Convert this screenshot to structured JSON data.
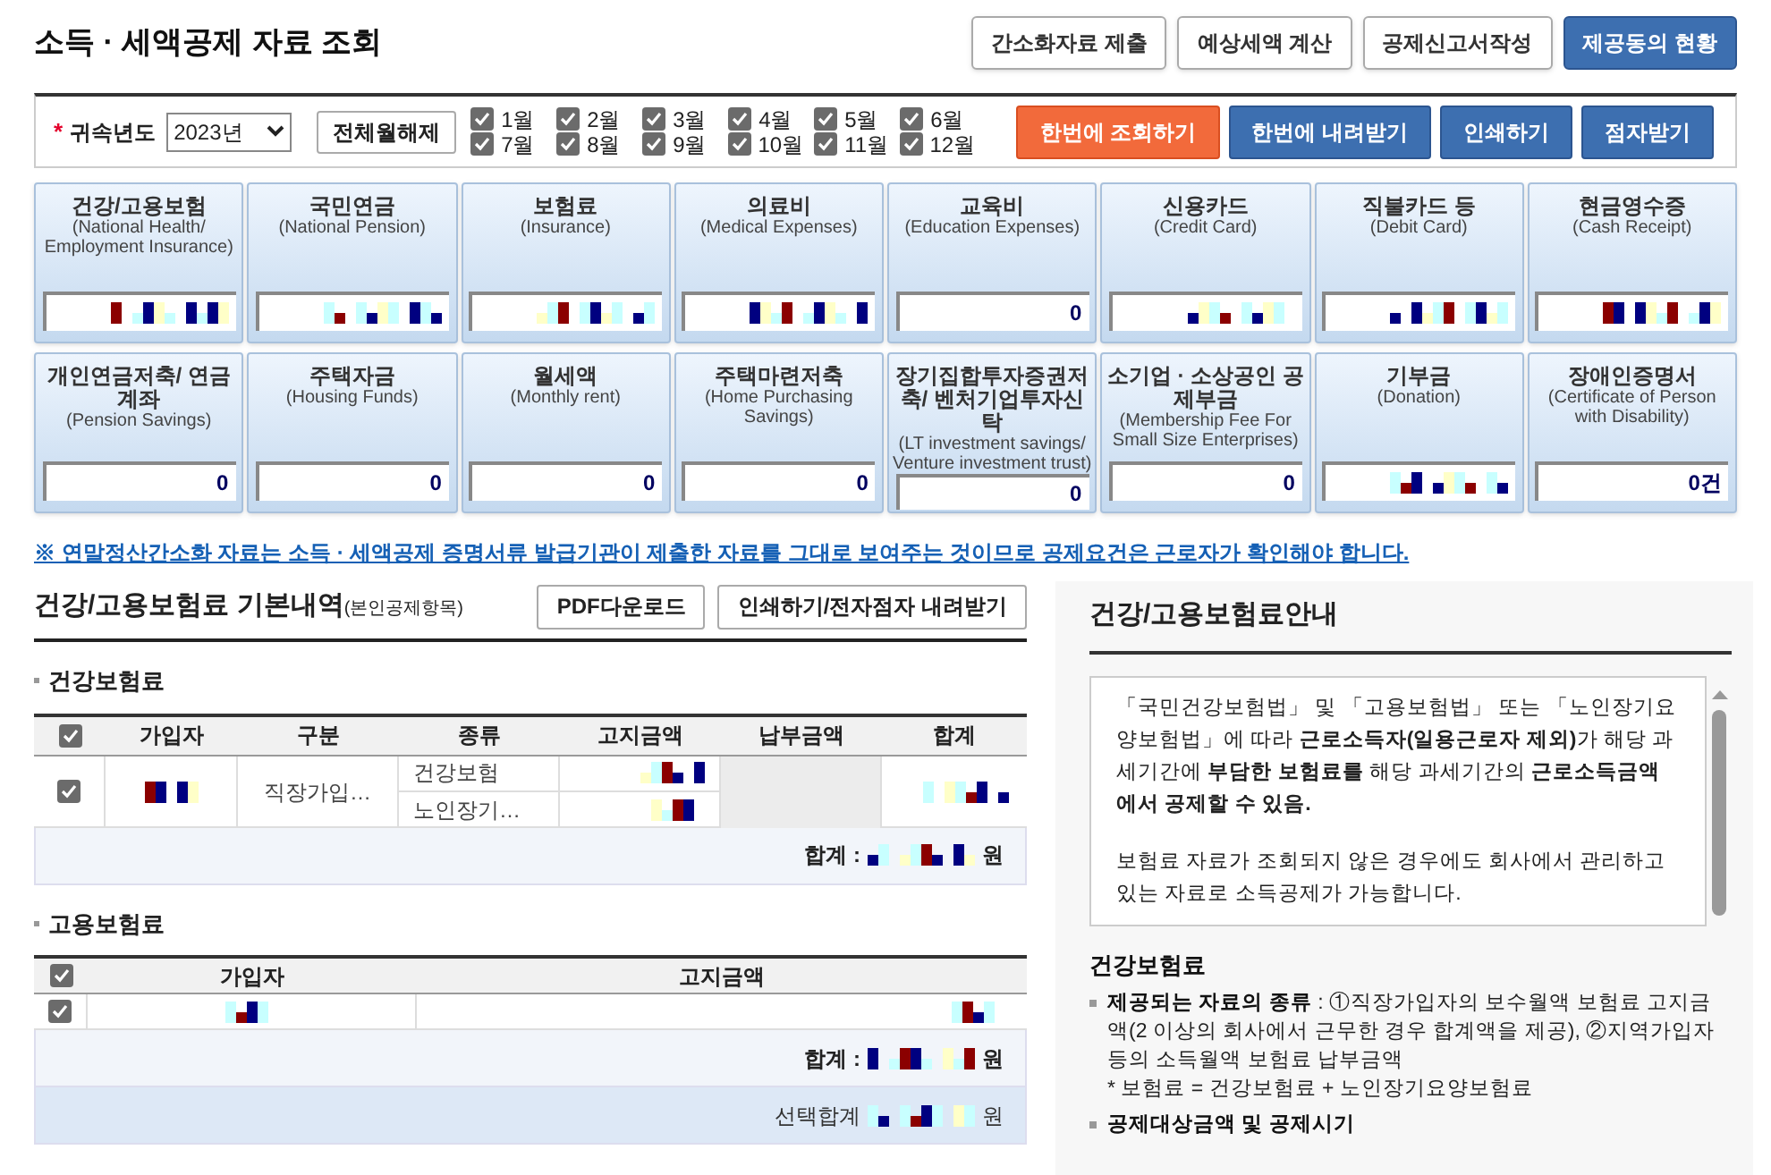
{
  "title": "소득 · 세액공제 자료 조회",
  "header_buttons": [
    {
      "label": "간소화자료 제출",
      "selected": false
    },
    {
      "label": "예상세액 계산",
      "selected": false
    },
    {
      "label": "공제신고서작성",
      "selected": false
    },
    {
      "label": "제공동의 현황",
      "selected": true
    }
  ],
  "toolbar": {
    "required_mark": "*",
    "year_label": "귀속년도",
    "year_value": "2023년",
    "clear_button": "전체월해제",
    "months": [
      {
        "label": "1월",
        "checked": true
      },
      {
        "label": "2월",
        "checked": true
      },
      {
        "label": "3월",
        "checked": true
      },
      {
        "label": "4월",
        "checked": true
      },
      {
        "label": "5월",
        "checked": true
      },
      {
        "label": "6월",
        "checked": true
      },
      {
        "label": "7월",
        "checked": true
      },
      {
        "label": "8월",
        "checked": true
      },
      {
        "label": "9월",
        "checked": true
      },
      {
        "label": "10월",
        "checked": true
      },
      {
        "label": "11월",
        "checked": true
      },
      {
        "label": "12월",
        "checked": true
      }
    ],
    "actions": [
      {
        "label": "한번에 조회하기",
        "kind": "orange"
      },
      {
        "label": "한번에 내려받기",
        "kind": "blue"
      },
      {
        "label": "인쇄하기",
        "kind": "blue"
      },
      {
        "label": "점자받기",
        "kind": "blue"
      }
    ]
  },
  "cards": [
    {
      "title": "건강/고용보험",
      "subtitle": "(National Health/ Employment Insurance)",
      "redacted": true
    },
    {
      "title": "국민연금",
      "subtitle": "(National Pension)",
      "redacted": true
    },
    {
      "title": "보험료",
      "subtitle": "(Insurance)",
      "redacted": true
    },
    {
      "title": "의료비",
      "subtitle": "(Medical Expenses)",
      "redacted": true
    },
    {
      "title": "교육비",
      "subtitle": "(Education Expenses)",
      "value": "0"
    },
    {
      "title": "신용카드",
      "subtitle": "(Credit Card)",
      "redacted": true
    },
    {
      "title": "직불카드 등",
      "subtitle": "(Debit Card)",
      "redacted": true
    },
    {
      "title": "현금영수증",
      "subtitle": "(Cash Receipt)",
      "redacted": true
    },
    {
      "title": "개인연금저축/ 연금계좌",
      "subtitle": "(Pension Savings)",
      "value": "0"
    },
    {
      "title": "주택자금",
      "subtitle": "(Housing Funds)",
      "value": "0"
    },
    {
      "title": "월세액",
      "subtitle": "(Monthly rent)",
      "value": "0"
    },
    {
      "title": "주택마련저축",
      "subtitle": "(Home Purchasing Savings)",
      "value": "0"
    },
    {
      "title": "장기집합투자증권저축/ 벤처기업투자신탁",
      "subtitle": "(LT investment savings/ Venture investment trust)",
      "value": "0"
    },
    {
      "title": "소기업 · 소상공인 공제부금",
      "subtitle": "(Membership Fee For Small Size Enterprises)",
      "value": "0"
    },
    {
      "title": "기부금",
      "subtitle": "(Donation)",
      "redacted": true
    },
    {
      "title": "장애인증명서",
      "subtitle": "(Certificate of Person with Disability)",
      "value": "0건"
    }
  ],
  "notice": "※ 연말정산간소화 자료는 소득 · 세액공제 증명서류 발급기관이 제출한 자료를 그대로 보여주는 것이므로 공제요건은 근로자가 확인해야 합니다.",
  "detail": {
    "title": "건강/고용보험료 기본내역",
    "title_note": "(본인공제항목)",
    "buttons": [
      "PDF다운로드",
      "인쇄하기/전자점자 내려받기"
    ],
    "health": {
      "heading": "건강보험료",
      "header_checked": true,
      "columns": [
        "가입자",
        "구분",
        "종류",
        "고지금액",
        "납부금액",
        "합계"
      ],
      "rows": [
        {
          "checked": true,
          "category": "직장가입…",
          "types": [
            "건강보험",
            "노인장기…"
          ]
        }
      ],
      "total_label": "합계 :",
      "unit": "원"
    },
    "employment": {
      "heading": "고용보험료",
      "header_checked": true,
      "columns": [
        "가입자",
        "고지금액"
      ],
      "rows": [
        {
          "checked": true
        }
      ],
      "total_label": "합계 :",
      "unit": "원"
    },
    "selected_total_label": "선택합계",
    "selected_total_unit": "원"
  },
  "guide": {
    "title": "건강/고용보험료안내",
    "paragraphs": [
      "「국민건강보험법」 및 「고용보험법」 또는 「노인장기요양보험법」에 따라 **근로소득자(일용근로자 제외)**가 해당 과세기간에 **부담한 보험료를** 해당 과세기간의 **근로소득금액에서 공제할 수 있음.**",
      "보험료 자료가 조회되지 않은 경우에도 회사에서 관리하고 있는 자료로 소득공제가 가능합니다."
    ],
    "section": "건강보험료",
    "bullets": [
      {
        "label": "제공되는 자료의 종류",
        "text": " : ①직장가입자의 보수월액 보험료 고지금액(2 이상의 회사에서 근무한 경우 합계액을 제공), ②지역가입자 등의 소득월액 보험료 납부금액",
        "note": "* 보험료 = 건강보험료 + 노인장기요양보험료"
      },
      {
        "label": "공제대상금액 및 공제시기"
      }
    ]
  }
}
